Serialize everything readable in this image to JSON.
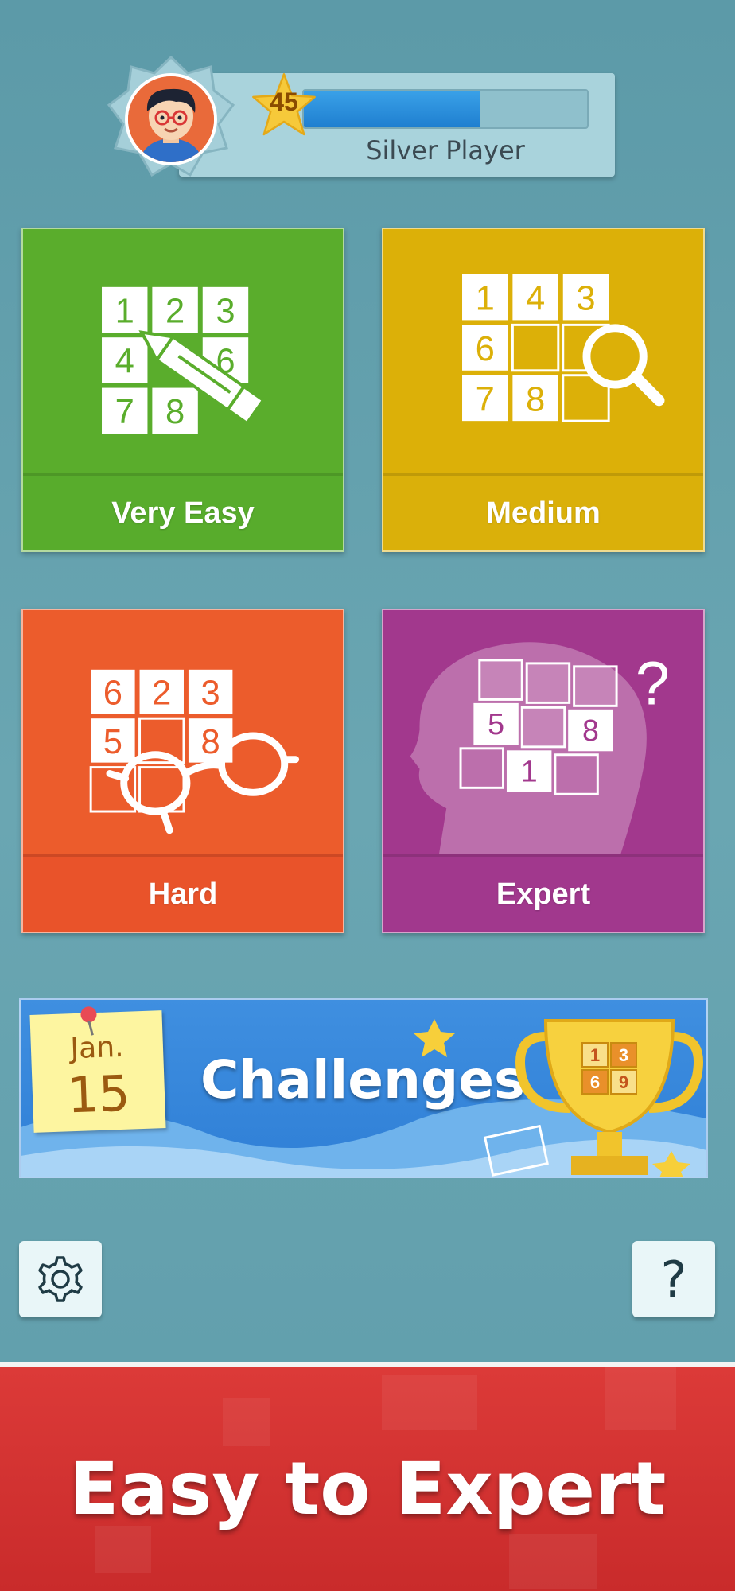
{
  "profile": {
    "level": "45",
    "title": "Silver Player",
    "xp_progress": 0.62
  },
  "difficulties": [
    {
      "id": "very-easy",
      "label": "Very Easy",
      "color": "#5aad2c",
      "grid": [
        "1",
        "2",
        "3",
        "4",
        "",
        "6",
        "7",
        "8",
        ""
      ]
    },
    {
      "id": "medium",
      "label": "Medium",
      "color": "#dcb008",
      "grid": [
        "1",
        "4",
        "3",
        "6",
        "",
        "",
        "7",
        "8",
        ""
      ]
    },
    {
      "id": "hard",
      "label": "Hard",
      "color": "#ec5c2c",
      "grid": [
        "6",
        "2",
        "3",
        "5",
        "",
        "8",
        "",
        "",
        ""
      ]
    },
    {
      "id": "expert",
      "label": "Expert",
      "color": "#a2388d",
      "grid": [
        "",
        "",
        "",
        "5",
        "",
        "8",
        "",
        "1",
        ""
      ]
    }
  ],
  "challenges": {
    "month": "Jan.",
    "day": "15",
    "title": "Challenges",
    "trophy_digits": [
      "1",
      "3",
      "6",
      "9"
    ]
  },
  "buttons": {
    "settings_icon": "gear-icon",
    "help_label": "?"
  },
  "promo": {
    "text": "Easy to Expert"
  }
}
